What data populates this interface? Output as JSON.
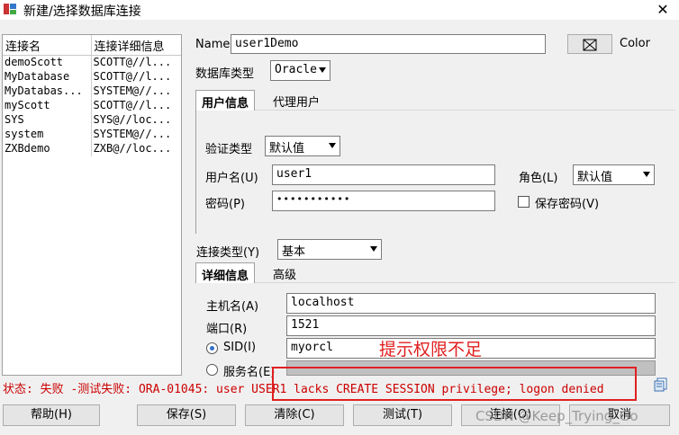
{
  "window": {
    "title": "新建/选择数据库连接",
    "close": "✕"
  },
  "connections": {
    "headers": [
      "连接名",
      "连接详细信息"
    ],
    "rows": [
      [
        "demoScott",
        "SCOTT@//l..."
      ],
      [
        "MyDatabase",
        "SCOTT@//l..."
      ],
      [
        "MyDatabas...",
        "SYSTEM@//..."
      ],
      [
        "myScott",
        "SCOTT@//l..."
      ],
      [
        "SYS",
        "SYS@//loc..."
      ],
      [
        "system",
        "SYSTEM@//..."
      ],
      [
        "ZXBdemo",
        "ZXB@//loc..."
      ]
    ]
  },
  "form": {
    "name_label": "Name",
    "name_value": "user1Demo",
    "color_label": "Color",
    "dbtype_label": "数据库类型",
    "dbtype_value": "Oracle",
    "tabs": [
      "用户信息",
      "代理用户"
    ],
    "auth_label": "验证类型",
    "auth_value": "默认值",
    "user_label": "用户名(U)",
    "user_value": "user1",
    "role_label": "角色(L)",
    "role_value": "默认值",
    "pwd_label": "密码(P)",
    "pwd_value": "•••••••••••",
    "save_pwd_label": "保存密码(V)",
    "conn_type_label": "连接类型(Y)",
    "conn_type_value": "基本",
    "detail_tabs": [
      "详细信息",
      "高级"
    ],
    "host_label": "主机名(A)",
    "host_value": "localhost",
    "port_label": "端口(R)",
    "port_value": "1521",
    "sid_label": "SID(I)",
    "sid_value": "myorcl",
    "service_label": "服务名(E)",
    "annotation": "提示权限不足"
  },
  "status": "状态: 失败 -测试失败: ORA-01045: user USER1 lacks CREATE SESSION privilege; logon denied",
  "buttons": {
    "help": "帮助(H)",
    "save": "保存(S)",
    "clear": "清除(C)",
    "test": "测试(T)",
    "connect": "连接(O)",
    "cancel": "取消"
  },
  "watermark": "CSDN @Keep_Trying_Go",
  "colors": {
    "status_red": "#cc0000",
    "annotation_red": "#e02020"
  }
}
